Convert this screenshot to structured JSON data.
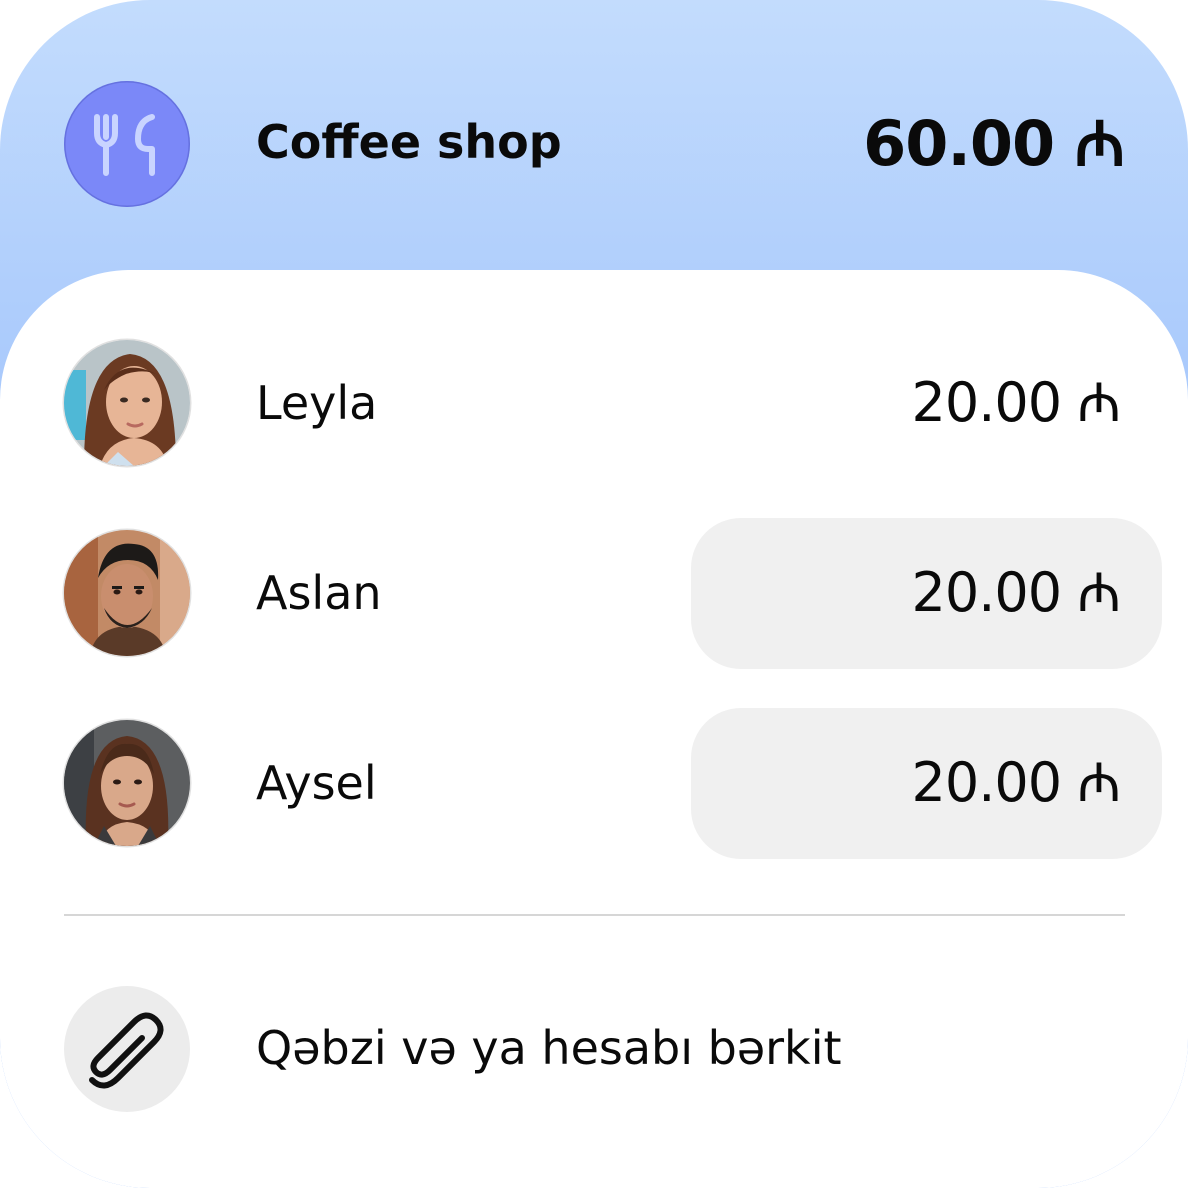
{
  "header": {
    "merchant_icon": "fork-knife-icon",
    "merchant_name": "Coffee shop",
    "total": "60.00 ₼",
    "accent_color": "#7b88f8",
    "gradient_top": "#c3dcfd",
    "gradient_bottom": "#7aa9fa"
  },
  "participants": [
    {
      "name": "Leyla",
      "amount": "20.00 ₼",
      "editable": false
    },
    {
      "name": "Aslan",
      "amount": "20.00 ₼",
      "editable": true
    },
    {
      "name": "Aysel",
      "amount": "20.00 ₼",
      "editable": true
    }
  ],
  "attach": {
    "icon": "paperclip-icon",
    "label": "Qəbzi və ya hesabı bərkit"
  }
}
